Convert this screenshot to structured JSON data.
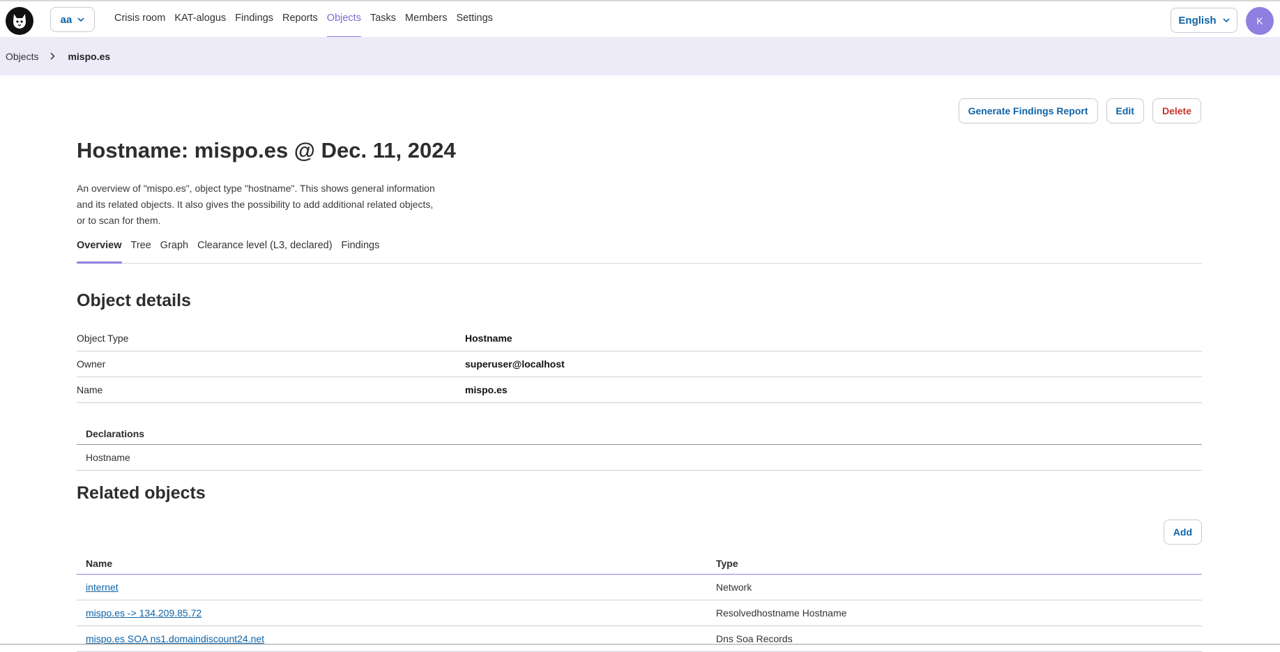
{
  "header": {
    "org_selector": "aa",
    "nav": [
      {
        "label": "Crisis room",
        "active": false
      },
      {
        "label": "KAT-alogus",
        "active": false
      },
      {
        "label": "Findings",
        "active": false
      },
      {
        "label": "Reports",
        "active": false
      },
      {
        "label": "Objects",
        "active": true
      },
      {
        "label": "Tasks",
        "active": false
      },
      {
        "label": "Members",
        "active": false
      },
      {
        "label": "Settings",
        "active": false
      }
    ],
    "language": "English",
    "avatar_initial": "K"
  },
  "breadcrumb": {
    "parent": "Objects",
    "current": "mispo.es"
  },
  "actions": {
    "generate": "Generate Findings Report",
    "edit": "Edit",
    "delete": "Delete"
  },
  "page": {
    "title": "Hostname: mispo.es @ Dec. 11, 2024",
    "intro": "An overview of \"mispo.es\", object type \"hostname\". This shows general information and its related objects. It also gives the possibility to add additional related objects, or to scan for them."
  },
  "tabs": [
    {
      "label": "Overview",
      "active": true
    },
    {
      "label": "Tree",
      "active": false
    },
    {
      "label": "Graph",
      "active": false
    },
    {
      "label": "Clearance level (L3, declared)",
      "active": false
    },
    {
      "label": "Findings",
      "active": false
    }
  ],
  "object_details": {
    "title": "Object details",
    "rows": [
      {
        "key": "Object Type",
        "value": "Hostname"
      },
      {
        "key": "Owner",
        "value": "superuser@localhost"
      },
      {
        "key": "Name",
        "value": "mispo.es"
      }
    ]
  },
  "declarations": {
    "header": "Declarations",
    "rows": [
      "Hostname"
    ]
  },
  "related_objects": {
    "title": "Related objects",
    "add_label": "Add",
    "columns": {
      "name": "Name",
      "type": "Type"
    },
    "rows": [
      {
        "name": "internet",
        "type": "Network"
      },
      {
        "name": "mispo.es -> 134.209.85.72",
        "type": "Resolvedhostname Hostname"
      },
      {
        "name": "mispo.es SOA ns1.domaindiscount24.net",
        "type": "Dns Soa Records"
      }
    ]
  },
  "colors": {
    "accent": "#8e7fe0",
    "link": "#0f63a6",
    "danger": "#c9302c",
    "breadcrumb_bg": "#edebf8"
  }
}
